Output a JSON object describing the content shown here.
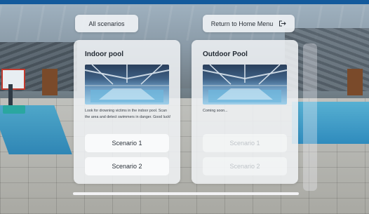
{
  "top_buttons": {
    "all_scenarios": "All scenarios",
    "return_home": "Return to Home Menu",
    "return_home_icon": "exit-icon"
  },
  "cards": [
    {
      "title": "Indoor pool",
      "description": "Look for drowning victims in the indoor pool. Scan the area and detect swimmers in danger. Good luck!",
      "buttons": [
        {
          "label": "Scenario 1",
          "enabled": true
        },
        {
          "label": "Scenario 2",
          "enabled": true
        }
      ]
    },
    {
      "title": "Outdoor Pool",
      "description": "Coming soon...",
      "buttons": [
        {
          "label": "Scenario 1",
          "enabled": false
        },
        {
          "label": "Scenario 2",
          "enabled": false
        }
      ]
    }
  ],
  "colors": {
    "panel_bg": "#f0f2f5",
    "top_bar": "#135a9c",
    "disabled_text": "#bfc4c9"
  }
}
